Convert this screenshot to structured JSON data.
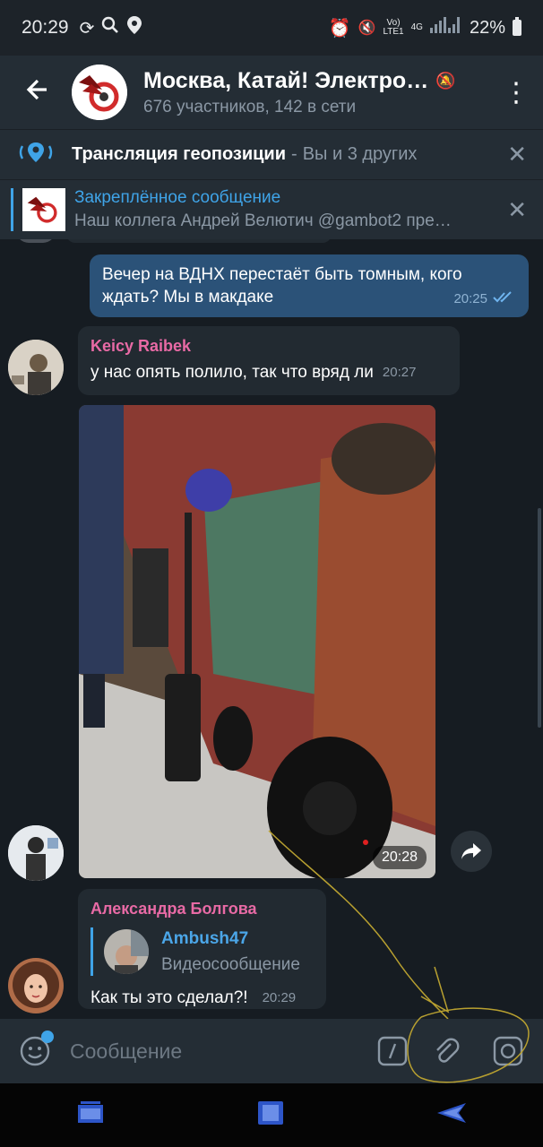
{
  "status": {
    "time": "20:29",
    "battery": "22%",
    "net_small_top": "Vo)",
    "net_small_bottom": "LTE1",
    "net_4g": "4G"
  },
  "header": {
    "title": "Москва, Катай! Электро…",
    "subtitle": "676 участников, 142 в сети"
  },
  "geo": {
    "label": "Трансляция геопозиции",
    "sep": "-",
    "detail": "Вы и 3 других"
  },
  "pinned": {
    "title": "Закреплённое сообщение",
    "text": "Наш коллега Андрей Велютич  @gambot2  пре…"
  },
  "messages": {
    "out1": {
      "text": "Вечер на ВДНХ  перестаёт быть  томным,  кого ждать? Мы в макдаке",
      "time": "20:25"
    },
    "keicy": {
      "sender": "Keicy Raibek",
      "text": "у нас опять полило, так что вряд ли",
      "time": "20:27"
    },
    "photo": {
      "time": "20:28"
    },
    "alex": {
      "sender": "Александра Болгова",
      "reply_name": "Ambush47",
      "reply_text": "Видеосообщение",
      "text": "Как ты это сделал?!",
      "time": "20:29"
    }
  },
  "input": {
    "placeholder": "Сообщение"
  },
  "colors": {
    "accent": "#3fa4e8",
    "outgoing": "#2b5278",
    "incoming": "#222a31",
    "sender": "#e86aa5"
  }
}
